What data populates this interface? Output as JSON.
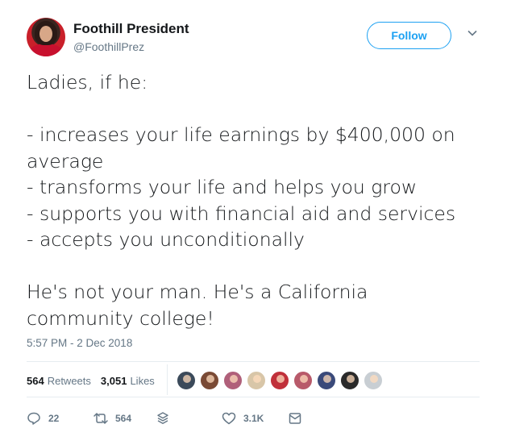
{
  "author": {
    "display_name": "Foothill President",
    "handle": "@FoothillPrez"
  },
  "follow_button": {
    "label": "Follow"
  },
  "tweet": {
    "lines": [
      "Ladies, if he:",
      "",
      "- increases your life earnings by $400,000 on",
      "average",
      "- transforms your life and helps you grow",
      "- supports you with financial aid and services",
      "- accepts you unconditionally",
      "",
      "He's not your man. He's a California",
      "community college!"
    ],
    "timestamp": "5:57 PM - 2 Dec 2018"
  },
  "stats": {
    "retweets_count": "564",
    "retweets_label": "Retweets",
    "likes_count": "3,051",
    "likes_label": "Likes"
  },
  "likers": [
    {
      "color": "#3b4a5a"
    },
    {
      "color": "#7a4a35"
    },
    {
      "color": "#b0607a"
    },
    {
      "color": "#d8c6a8"
    },
    {
      "color": "#c0303a"
    },
    {
      "color": "#b85a6a"
    },
    {
      "color": "#3a4a7a"
    },
    {
      "color": "#2a2a2a"
    },
    {
      "color": "#c8ced3"
    }
  ],
  "actions": {
    "reply_count": "22",
    "retweet_count": "564",
    "like_count": "3.1K"
  },
  "colors": {
    "brand": "#1da1f2",
    "text": "#14171a",
    "muted": "#657786"
  }
}
